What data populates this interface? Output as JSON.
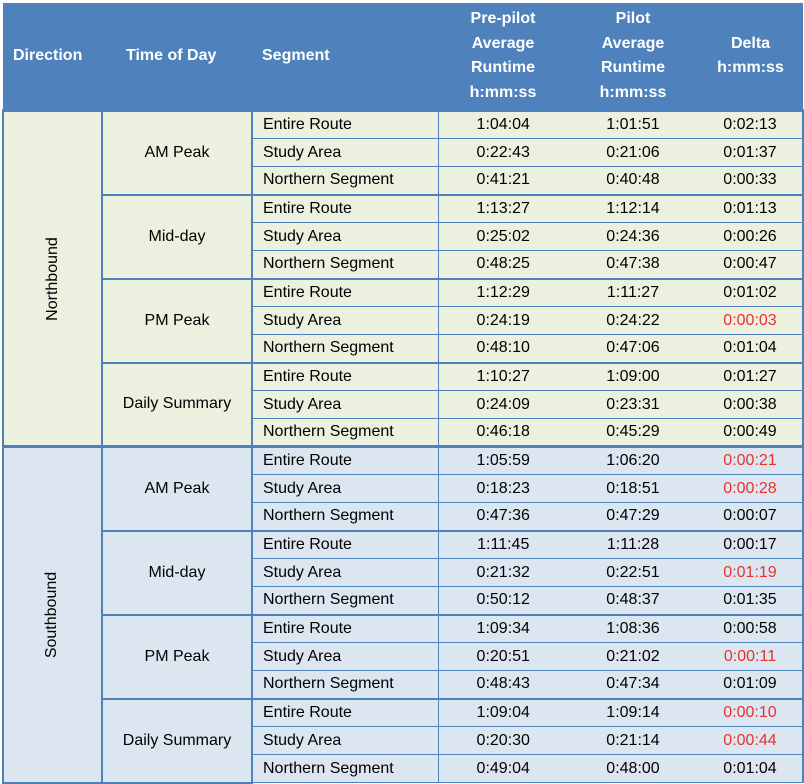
{
  "colors": {
    "header_bg": "#4F81BD",
    "northbound_bg": "#EBF1DE",
    "southbound_bg": "#DCE6F1",
    "negative_delta": "#E8312F"
  },
  "header": {
    "direction": "Direction",
    "time_of_day": "Time of Day",
    "segment": "Segment",
    "pre_pilot": [
      "Pre-pilot",
      "Average",
      "Runtime",
      "h:mm:ss"
    ],
    "pilot": [
      "Pilot",
      "Average",
      "Runtime",
      "h:mm:ss"
    ],
    "delta": [
      "Delta",
      "h:mm:ss"
    ]
  },
  "directions": [
    {
      "name": "Northbound",
      "periods": [
        {
          "name": "AM Peak",
          "rows": [
            {
              "segment": "Entire Route",
              "pre": "1:04:04",
              "pilot": "1:01:51",
              "delta": "0:02:13",
              "negative": false
            },
            {
              "segment": "Study Area",
              "pre": "0:22:43",
              "pilot": "0:21:06",
              "delta": "0:01:37",
              "negative": false
            },
            {
              "segment": "Northern Segment",
              "pre": "0:41:21",
              "pilot": "0:40:48",
              "delta": "0:00:33",
              "negative": false
            }
          ]
        },
        {
          "name": "Mid-day",
          "rows": [
            {
              "segment": "Entire Route",
              "pre": "1:13:27",
              "pilot": "1:12:14",
              "delta": "0:01:13",
              "negative": false
            },
            {
              "segment": "Study Area",
              "pre": "0:25:02",
              "pilot": "0:24:36",
              "delta": "0:00:26",
              "negative": false
            },
            {
              "segment": "Northern Segment",
              "pre": "0:48:25",
              "pilot": "0:47:38",
              "delta": "0:00:47",
              "negative": false
            }
          ]
        },
        {
          "name": "PM Peak",
          "rows": [
            {
              "segment": "Entire Route",
              "pre": "1:12:29",
              "pilot": "1:11:27",
              "delta": "0:01:02",
              "negative": false
            },
            {
              "segment": "Study Area",
              "pre": "0:24:19",
              "pilot": "0:24:22",
              "delta": "0:00:03",
              "negative": true
            },
            {
              "segment": "Northern Segment",
              "pre": "0:48:10",
              "pilot": "0:47:06",
              "delta": "0:01:04",
              "negative": false
            }
          ]
        },
        {
          "name": "Daily Summary",
          "rows": [
            {
              "segment": "Entire Route",
              "pre": "1:10:27",
              "pilot": "1:09:00",
              "delta": "0:01:27",
              "negative": false
            },
            {
              "segment": "Study Area",
              "pre": "0:24:09",
              "pilot": "0:23:31",
              "delta": "0:00:38",
              "negative": false
            },
            {
              "segment": "Northern Segment",
              "pre": "0:46:18",
              "pilot": "0:45:29",
              "delta": "0:00:49",
              "negative": false
            }
          ]
        }
      ]
    },
    {
      "name": "Southbound",
      "periods": [
        {
          "name": "AM Peak",
          "rows": [
            {
              "segment": "Entire Route",
              "pre": "1:05:59",
              "pilot": "1:06:20",
              "delta": "0:00:21",
              "negative": true
            },
            {
              "segment": "Study Area",
              "pre": "0:18:23",
              "pilot": "0:18:51",
              "delta": "0:00:28",
              "negative": true
            },
            {
              "segment": "Northern Segment",
              "pre": "0:47:36",
              "pilot": "0:47:29",
              "delta": "0:00:07",
              "negative": false
            }
          ]
        },
        {
          "name": "Mid-day",
          "rows": [
            {
              "segment": "Entire Route",
              "pre": "1:11:45",
              "pilot": "1:11:28",
              "delta": "0:00:17",
              "negative": false
            },
            {
              "segment": "Study Area",
              "pre": "0:21:32",
              "pilot": "0:22:51",
              "delta": "0:01:19",
              "negative": true
            },
            {
              "segment": "Northern Segment",
              "pre": "0:50:12",
              "pilot": "0:48:37",
              "delta": "0:01:35",
              "negative": false
            }
          ]
        },
        {
          "name": "PM Peak",
          "rows": [
            {
              "segment": "Entire Route",
              "pre": "1:09:34",
              "pilot": "1:08:36",
              "delta": "0:00:58",
              "negative": false
            },
            {
              "segment": "Study Area",
              "pre": "0:20:51",
              "pilot": "0:21:02",
              "delta": "0:00:11",
              "negative": true
            },
            {
              "segment": "Northern Segment",
              "pre": "0:48:43",
              "pilot": "0:47:34",
              "delta": "0:01:09",
              "negative": false
            }
          ]
        },
        {
          "name": "Daily Summary",
          "rows": [
            {
              "segment": "Entire Route",
              "pre": "1:09:04",
              "pilot": "1:09:14",
              "delta": "0:00:10",
              "negative": true
            },
            {
              "segment": "Study Area",
              "pre": "0:20:30",
              "pilot": "0:21:14",
              "delta": "0:00:44",
              "negative": true
            },
            {
              "segment": "Northern Segment",
              "pre": "0:49:04",
              "pilot": "0:48:00",
              "delta": "0:01:04",
              "negative": false
            }
          ]
        }
      ]
    }
  ]
}
